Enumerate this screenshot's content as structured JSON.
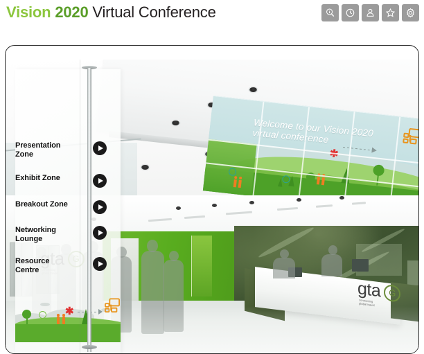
{
  "header": {
    "title_brand": "Vision",
    "title_year": "2020",
    "title_rest": "Virtual Conference",
    "brand_color": "#8cc63e",
    "year_color": "#5a9e28",
    "text_color": "#231f20",
    "toolbar": {
      "button_color": "#9b9b9b",
      "buttons": [
        {
          "name": "search-info-icon",
          "label": "Search"
        },
        {
          "name": "clock-icon",
          "label": "History"
        },
        {
          "name": "user-icon",
          "label": "Profile"
        },
        {
          "name": "star-icon",
          "label": "Favourites"
        },
        {
          "name": "gear-icon",
          "label": "Settings"
        }
      ]
    }
  },
  "nav": {
    "items": [
      {
        "label": "Presentation\nZone",
        "arrow": "chevron-right-icon"
      },
      {
        "label": "Exhibit Zone",
        "arrow": "chevron-right-icon"
      },
      {
        "label": "Breakout Zone",
        "arrow": "chevron-right-icon"
      },
      {
        "label": "Networking\nLounge",
        "arrow": "chevron-right-icon"
      },
      {
        "label": "Resource\nCentre",
        "arrow": "chevron-right-icon"
      }
    ]
  },
  "scene": {
    "banner_text": "Welcome to our Vision 2020\nvirtual conference",
    "accent_green": "#4da128",
    "accent_orange": "#ef7d22",
    "accent_red": "#e03131",
    "glass_tint": "#c4e0e2",
    "logo_wall": {
      "word": "gta",
      "mark": "G",
      "tagline": "connecting\nglobal travel"
    },
    "logo_desk": {
      "word": "gta",
      "mark": "G",
      "tagline": "connecting\nglobal travel"
    }
  }
}
